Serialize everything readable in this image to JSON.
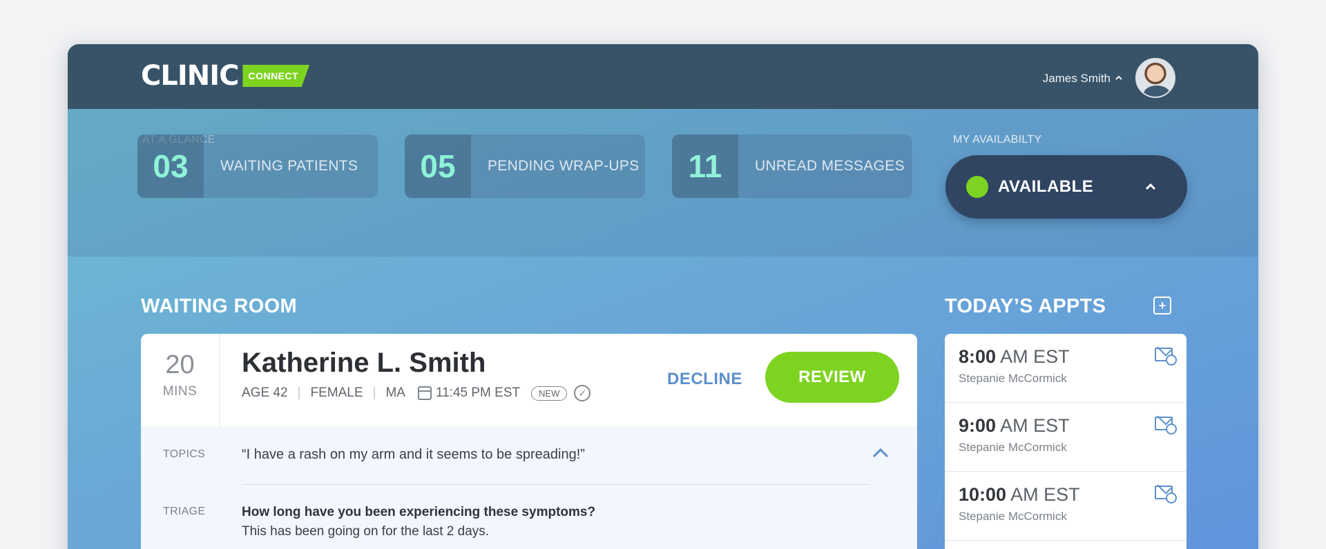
{
  "brand": {
    "name": "CLINIC",
    "badge": "CONNECT"
  },
  "user": {
    "name": "James Smith",
    "menu_icon": "chevron-up-icon"
  },
  "glance": {
    "label": "AT A GLANCE",
    "stats": [
      {
        "value": "03",
        "label": "WAITING PATIENTS"
      },
      {
        "value": "05",
        "label": "PENDING WRAP-UPS"
      },
      {
        "value": "11",
        "label": "UNREAD MESSAGES"
      }
    ]
  },
  "availability": {
    "label": "MY AVAILABILTY",
    "status": "AVAILABLE",
    "status_color": "#7ed321"
  },
  "waiting_room": {
    "title": "WAITING ROOM",
    "patient": {
      "wait_value": "20",
      "wait_unit": "MINS",
      "name": "Katherine L. Smith",
      "age": "AGE 42",
      "gender": "FEMALE",
      "state": "MA",
      "time": "11:45 PM EST",
      "badge": "NEW",
      "decline_label": "DECLINE",
      "review_label": "REVIEW",
      "topics_label": "TOPICS",
      "topics_text": "“I have a rash on my arm and it seems to be spreading!”",
      "triage_label": "TRIAGE",
      "triage_question": "How long have you been experiencing these symptoms?",
      "triage_answer": "This has been going on for the last 2 days."
    }
  },
  "appointments": {
    "title": "TODAY’S APPTS",
    "items": [
      {
        "hour": "8:00",
        "suffix": "AM EST",
        "name": "Stepanie McCormick"
      },
      {
        "hour": "9:00",
        "suffix": "AM EST",
        "name": "Stepanie McCormick"
      },
      {
        "hour": "10:00",
        "suffix": "AM EST",
        "name": "Stepanie McCormick"
      }
    ]
  },
  "colors": {
    "topbar": "#385368",
    "accent_green": "#7ed321",
    "stat_number": "#8ff2d8",
    "link_blue": "#5b8fcb"
  }
}
